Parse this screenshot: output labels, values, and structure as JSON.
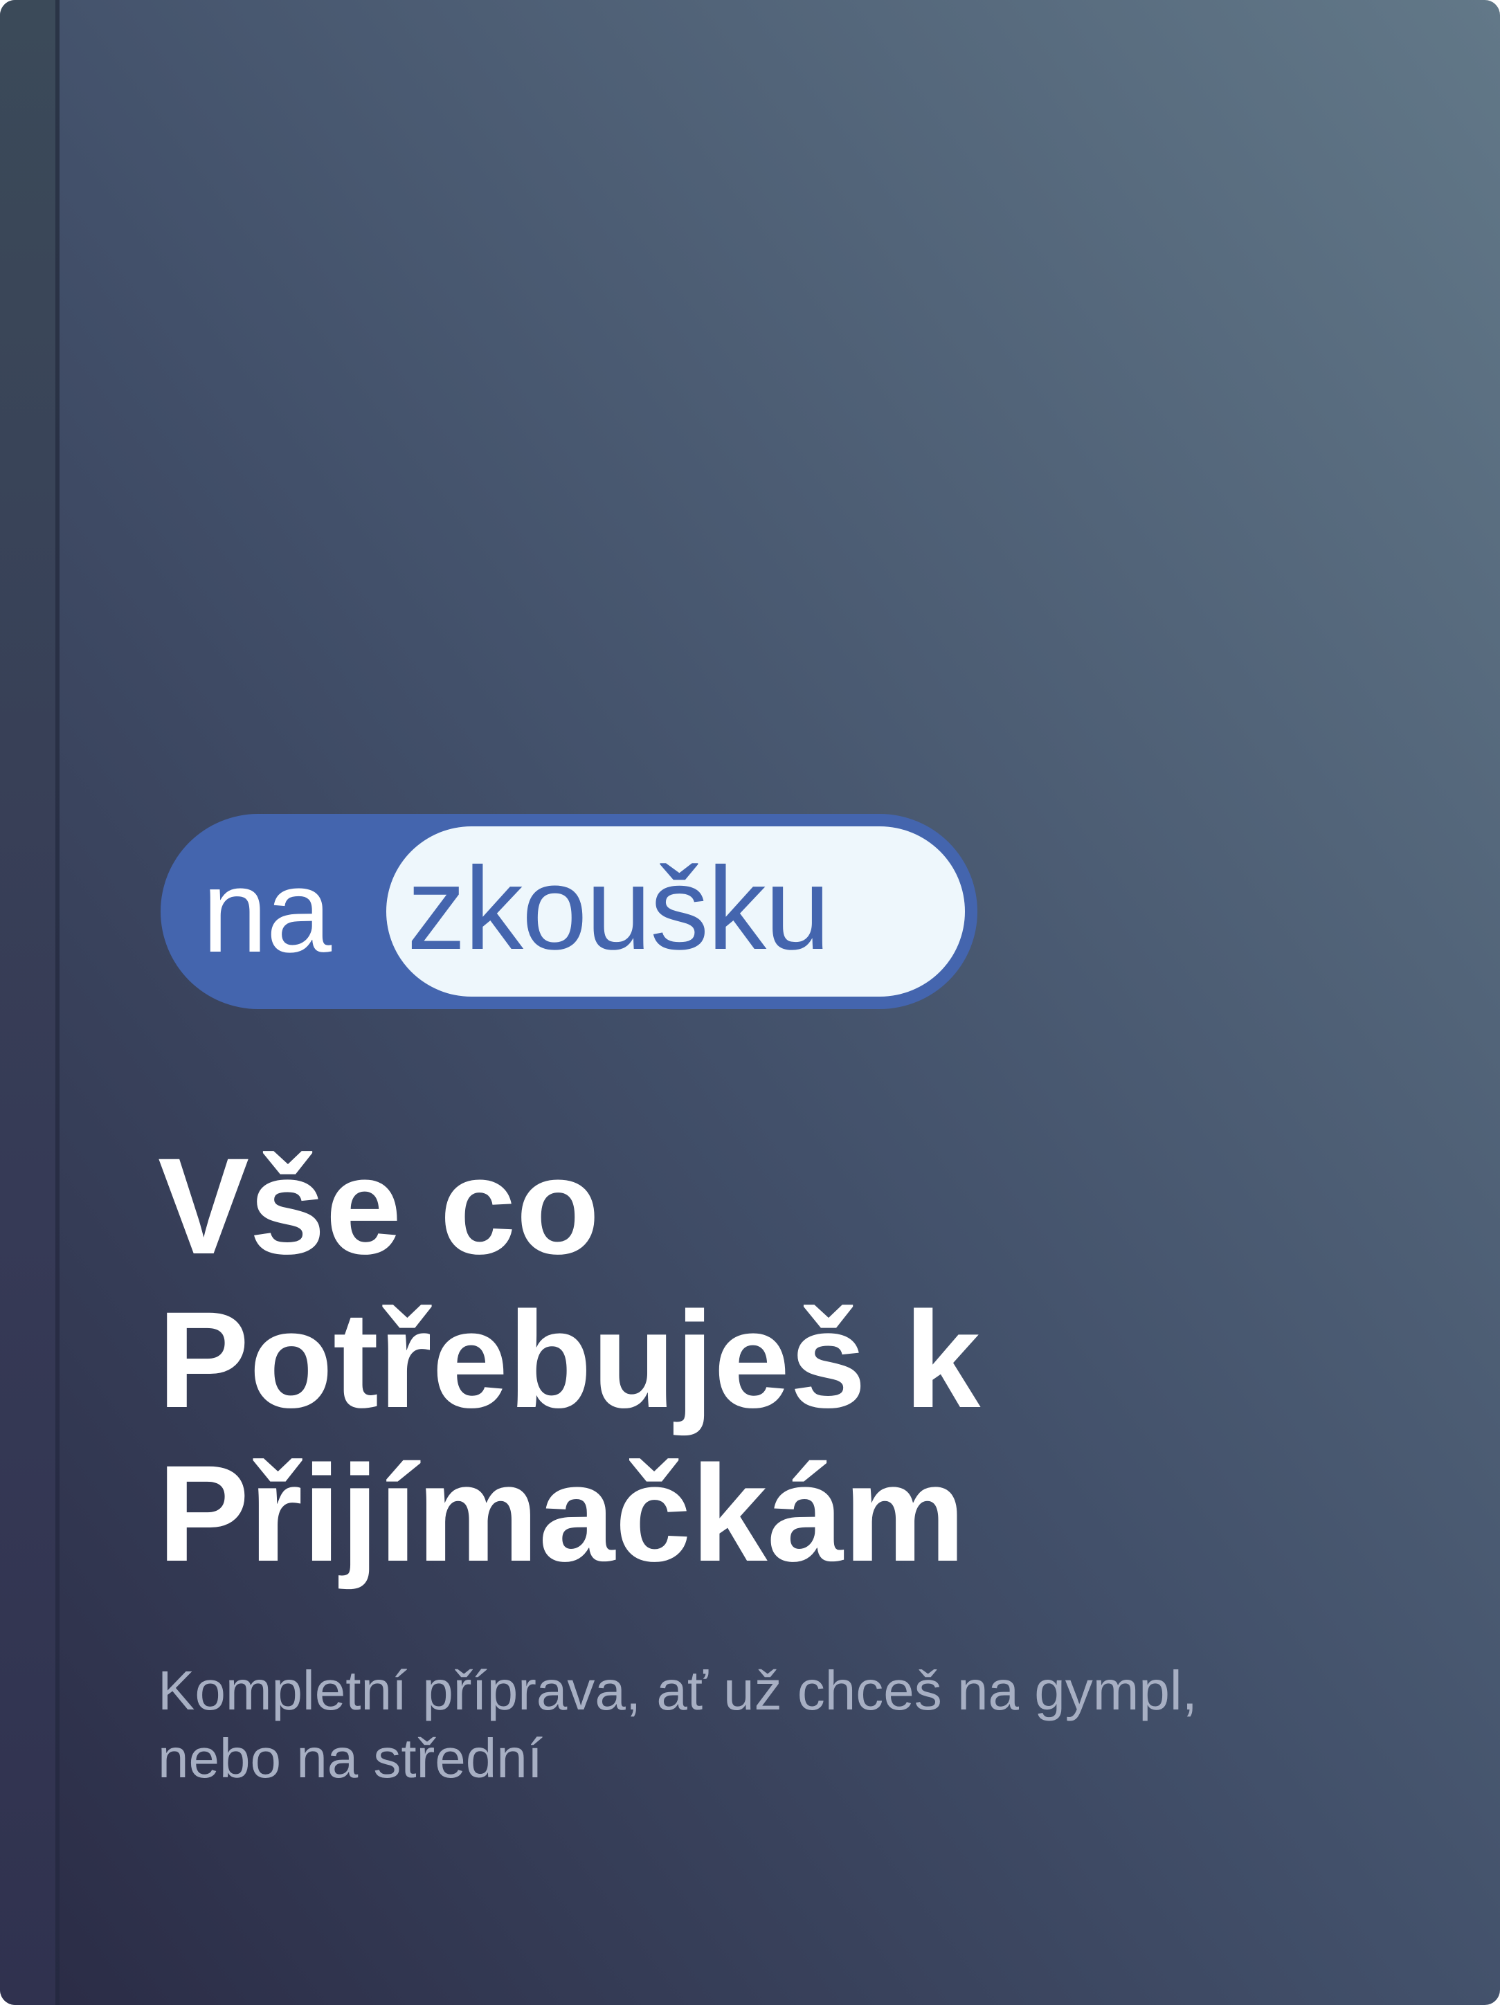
{
  "logo": {
    "prefix": "na",
    "word": "zkoušku",
    "colors": {
      "brand_blue": "#4465ae",
      "pill_fill": "#eef7fc"
    }
  },
  "title": {
    "lines": [
      "Vše co",
      "Potřebuješ k",
      "Přijímačkám"
    ]
  },
  "subtitle": {
    "lines": [
      "Kompletní příprava, ať už chceš na gympl,",
      "nebo na střední"
    ]
  },
  "colors": {
    "gradient_dark": "#2a2b45",
    "gradient_mid": "#42506a",
    "gradient_light": "#627888",
    "title": "#ffffff",
    "subtitle": "#a7afc3"
  }
}
